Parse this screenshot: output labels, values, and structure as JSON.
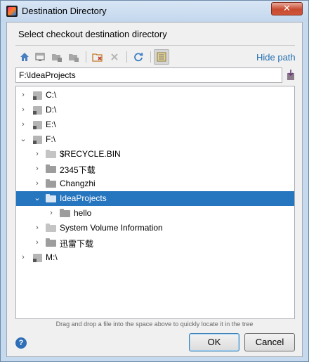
{
  "window": {
    "title": "Destination Directory",
    "close_glyph": "✕"
  },
  "heading": "Select checkout destination directory",
  "toolbar": {
    "buttons": [
      {
        "icon": "home-icon"
      },
      {
        "icon": "desktop-icon"
      },
      {
        "icon": "project-folder-icon"
      },
      {
        "icon": "module-folder-icon"
      },
      {
        "icon": "new-folder-icon"
      },
      {
        "icon": "delete-icon"
      },
      {
        "icon": "refresh-icon"
      },
      {
        "icon": "show-hidden-icon"
      }
    ],
    "hide_path_label": "Hide path"
  },
  "path": {
    "value": "F:\\IdeaProjects"
  },
  "tree": {
    "items": [
      {
        "label": "C:\\",
        "kind": "drive",
        "depth": 0,
        "arrow": "›",
        "expanded": false
      },
      {
        "label": "D:\\",
        "kind": "drive",
        "depth": 0,
        "arrow": "›",
        "expanded": false
      },
      {
        "label": "E:\\",
        "kind": "drive",
        "depth": 0,
        "arrow": "›",
        "expanded": false
      },
      {
        "label": "F:\\",
        "kind": "drive",
        "depth": 0,
        "arrow": "⌄",
        "expanded": true
      },
      {
        "label": "$RECYCLE.BIN",
        "kind": "folder-light",
        "depth": 1,
        "arrow": "›",
        "expanded": false
      },
      {
        "label": "2345下载",
        "kind": "folder",
        "depth": 1,
        "arrow": "›",
        "expanded": false
      },
      {
        "label": "Changzhi",
        "kind": "folder",
        "depth": 1,
        "arrow": "›",
        "expanded": false
      },
      {
        "label": "IdeaProjects",
        "kind": "folder",
        "depth": 1,
        "arrow": "⌄",
        "expanded": true,
        "selected": true
      },
      {
        "label": "hello",
        "kind": "folder",
        "depth": 2,
        "arrow": "›",
        "expanded": false
      },
      {
        "label": "System Volume Information",
        "kind": "folder-light",
        "depth": 1,
        "arrow": "›",
        "expanded": false
      },
      {
        "label": "迅雷下载",
        "kind": "folder",
        "depth": 1,
        "arrow": "›",
        "expanded": false
      },
      {
        "label": "M:\\",
        "kind": "drive",
        "depth": 0,
        "arrow": "›",
        "expanded": false
      }
    ]
  },
  "hint": "Drag and drop a file into the space above to quickly locate it in the tree",
  "buttons": {
    "help": "?",
    "ok": "OK",
    "cancel": "Cancel"
  },
  "colors": {
    "selection": "#2675bf",
    "link": "#2470b3",
    "title_bar": "#c5d9ef"
  }
}
